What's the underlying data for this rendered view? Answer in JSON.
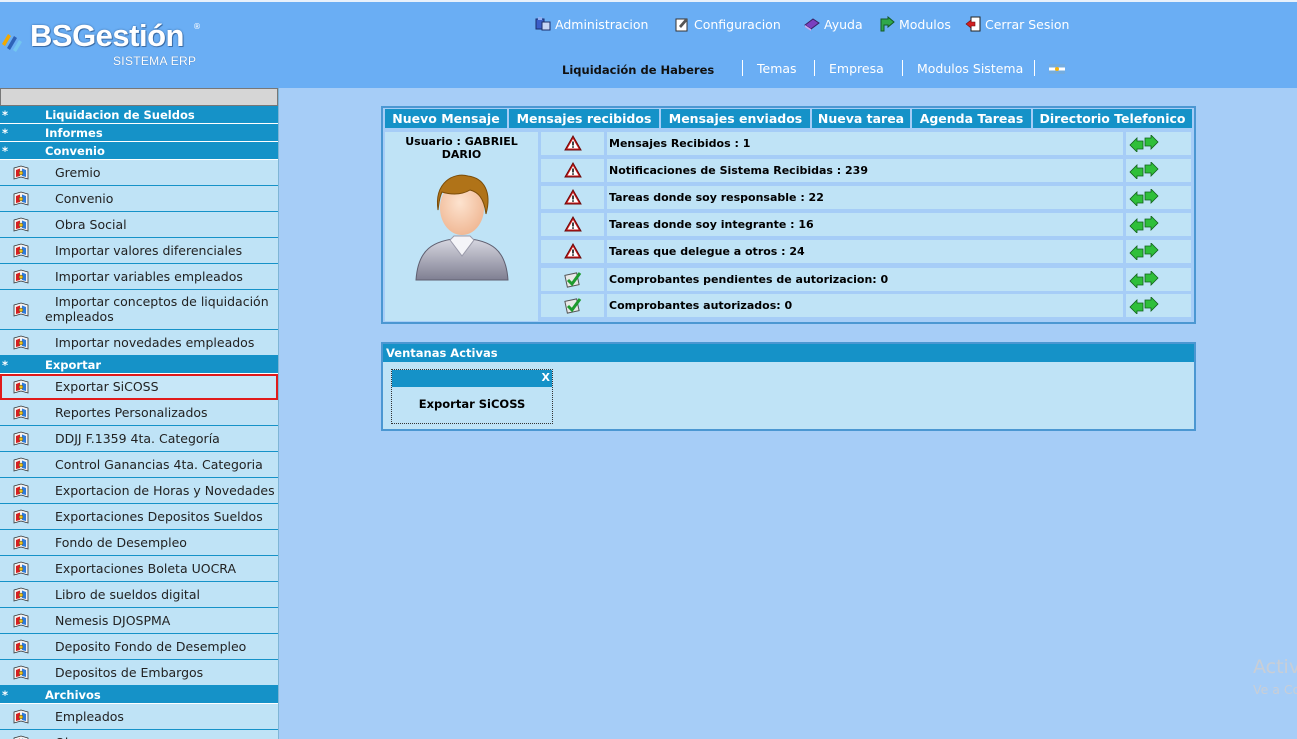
{
  "header": {
    "brand": "BSGestión",
    "brand_reg": "®",
    "brand_sub": "SISTEMA ERP",
    "nav": [
      {
        "label": "Administracion",
        "icon": "admin-icon"
      },
      {
        "label": "Configuracion",
        "icon": "config-icon"
      },
      {
        "label": "Ayuda",
        "icon": "help-icon"
      },
      {
        "label": "Modulos",
        "icon": "modules-icon"
      },
      {
        "label": "Cerrar Sesion",
        "icon": "logout-icon"
      }
    ],
    "module_title": "Liquidación de Haberes",
    "sublinks": [
      "Temas",
      "Empresa",
      "Modulos Sistema"
    ]
  },
  "sidebar": {
    "sections": [
      {
        "label": "Liquidacion de Sueldos",
        "star": "*"
      },
      {
        "label": "Informes",
        "star": "*"
      },
      {
        "label": "Convenio",
        "star": "*"
      },
      {
        "label": "Exportar",
        "star": "*"
      },
      {
        "label": "Archivos",
        "star": "*"
      }
    ],
    "convenio_items": [
      "Gremio",
      "Convenio",
      "Obra Social",
      "Importar valores diferenciales",
      "Importar variables empleados",
      "Importar conceptos de liquidación empleados",
      "Importar novedades empleados"
    ],
    "exportar_items": [
      "Exportar SiCOSS",
      "Reportes Personalizados",
      "DDJJ F.1359 4ta. Categoría",
      "Control Ganancias 4ta. Categoria",
      "Exportacion de Horas y Novedades",
      "Exportaciones Depositos Sueldos",
      "Fondo de Desempleo",
      "Exportaciones Boleta UOCRA",
      "Libro de sueldos digital",
      "Nemesis DJOSPMA",
      "Deposito Fondo de Desempleo",
      "Depositos de Embargos"
    ],
    "archivos_items": [
      "Empleados",
      "Obra"
    ],
    "selected_item": "Exportar SiCOSS"
  },
  "messages": {
    "tabs": [
      "Nuevo Mensaje",
      "Mensajes recibidos",
      "Mensajes enviados",
      "Nueva tarea",
      "Agenda Tareas",
      "Directorio Telefonico"
    ],
    "user_label": "Usuario : GABRIEL DARIO",
    "notifications": [
      {
        "text": "Mensajes Recibidos : 1",
        "status": "warning"
      },
      {
        "text": "Notificaciones de Sistema Recibidas : 239",
        "status": "warning"
      },
      {
        "text": "Tareas donde soy responsable : 22",
        "status": "warning"
      },
      {
        "text": "Tareas donde soy integrante : 16",
        "status": "warning"
      },
      {
        "text": "Tareas que delegue a otros : 24",
        "status": "warning"
      },
      {
        "text": "Comprobantes pendientes de autorizacion: 0",
        "status": "ok"
      },
      {
        "text": "Comprobantes autorizados: 0",
        "status": "ok"
      }
    ]
  },
  "active_windows": {
    "title": "Ventanas Activas",
    "close_label": "X",
    "windows": [
      "Exportar SiCOSS"
    ]
  },
  "watermark": {
    "line1": "Activ",
    "line2": "Ve a Co"
  },
  "colors": {
    "header": "#6aaef4",
    "accent": "#1592c8",
    "background": "#a6cdf7",
    "row": "#bfe3f6",
    "selected_outline": "#e01b1b"
  }
}
